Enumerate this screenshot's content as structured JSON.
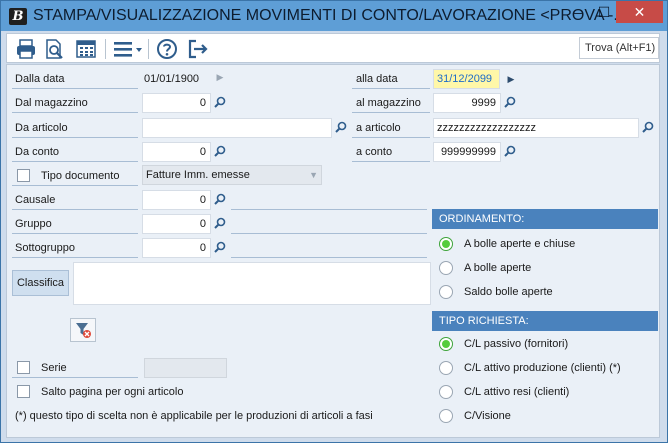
{
  "window": {
    "title": "STAMPA/VISUALIZZAZIONE MOVIMENTI DI CONTO/LAVORAZIONE <PROVA -...",
    "app_icon_letter": "B",
    "minimize_glyph": "–",
    "maximize_glyph": "☐",
    "close_glyph": "✕"
  },
  "toolbar": {
    "icons": [
      "print-icon",
      "print-preview-icon",
      "calculator-icon",
      "menu-icon",
      "help-icon",
      "exit-icon"
    ],
    "search_label": "Trova (Alt+F1)"
  },
  "form": {
    "dalla_data": {
      "label": "Dalla data",
      "value": "01/01/1900"
    },
    "alla_data": {
      "label": "alla data",
      "value": "31/12/2099"
    },
    "dal_magazzino": {
      "label": "Dal magazzino",
      "value": "0"
    },
    "al_magazzino": {
      "label": "al magazzino",
      "value": "9999"
    },
    "da_articolo": {
      "label": "Da articolo",
      "value": ""
    },
    "a_articolo": {
      "label": "a articolo",
      "value": "zzzzzzzzzzzzzzzzzz"
    },
    "da_conto": {
      "label": "Da conto",
      "value": "0"
    },
    "a_conto": {
      "label": "a conto",
      "value": "999999999"
    },
    "tipo_documento": {
      "label": "Tipo documento",
      "value": "Fatture Imm. emesse",
      "checked": false
    },
    "causale": {
      "label": "Causale",
      "value": "0"
    },
    "gruppo": {
      "label": "Gruppo",
      "value": "0"
    },
    "sottogruppo": {
      "label": "Sottogruppo",
      "value": "0"
    },
    "classifica": {
      "label": "Classifica"
    },
    "serie": {
      "label": "Serie",
      "checked": false
    },
    "salto_pagina": {
      "label": "Salto pagina per ogni articolo",
      "checked": false
    },
    "note": "(*) questo tipo di scelta non è applicabile per le produzioni di articoli a fasi"
  },
  "ordinamento": {
    "title": "ORDINAMENTO:",
    "options": [
      {
        "label": "A bolle aperte e chiuse",
        "selected": true
      },
      {
        "label": "A bolle aperte",
        "selected": false
      },
      {
        "label": "Saldo bolle aperte",
        "selected": false
      }
    ]
  },
  "tipo_richiesta": {
    "title": "TIPO RICHIESTA:",
    "options": [
      {
        "label": "C/L passivo (fornitori)",
        "selected": true
      },
      {
        "label": "C/L attivo produzione (clienti) (*)",
        "selected": false
      },
      {
        "label": "C/L attivo resi (clienti)",
        "selected": false
      },
      {
        "label": "C/Visione",
        "selected": false
      }
    ]
  },
  "colors": {
    "titlebar": "#5e9ed6",
    "section_header": "#4a82bd",
    "close_button": "#c74b47",
    "highlight_field": "#fff7a8",
    "radio_selected": "#55cc3c"
  }
}
